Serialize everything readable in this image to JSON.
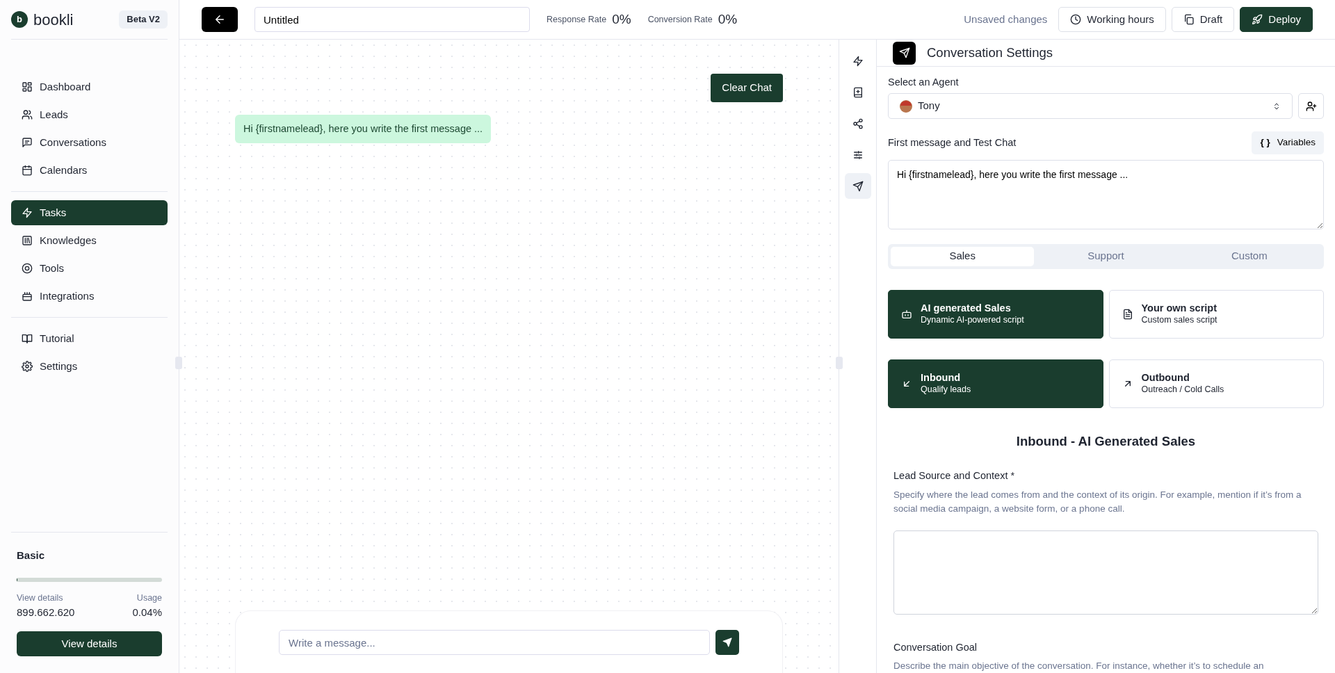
{
  "sidebar": {
    "brand": {
      "letter": "b",
      "name": "bookli",
      "badge": "Beta V2"
    },
    "nav_groups": [
      [
        {
          "label": "Dashboard",
          "selected": false
        },
        {
          "label": "Leads",
          "selected": false
        },
        {
          "label": "Conversations",
          "selected": false
        },
        {
          "label": "Calendars",
          "selected": false
        }
      ],
      [
        {
          "label": "Tasks",
          "selected": true
        },
        {
          "label": "Knowledges",
          "selected": false
        },
        {
          "label": "Tools",
          "selected": false
        },
        {
          "label": "Integrations",
          "selected": false
        }
      ],
      [
        {
          "label": "Tutorial",
          "selected": false
        },
        {
          "label": "Settings",
          "selected": false
        }
      ]
    ],
    "plan": {
      "name": "Basic",
      "level": 0.0004,
      "details_label": "View details",
      "details_value": "899.662.620",
      "usage_label": "Usage",
      "usage_value": "0.04%",
      "button": "View details"
    }
  },
  "topbar": {
    "title_value": "Untitled",
    "stats": [
      {
        "label": "Response Rate",
        "value": "0%"
      },
      {
        "label": "Conversion Rate",
        "value": "0%"
      }
    ],
    "unsaved": "Unsaved changes",
    "buttons": [
      {
        "label": "Working hours",
        "kind": "outline"
      },
      {
        "label": "Draft",
        "kind": "outline"
      },
      {
        "label": "Deploy",
        "kind": "primary"
      }
    ]
  },
  "chat": {
    "clear_button": "Clear Chat",
    "messages": [
      {
        "text": "Hi {firstnamelead}, here you write the first message ..."
      }
    ],
    "input": {
      "placeholder": "Write a message..."
    }
  },
  "rail": {
    "items": [
      {
        "selected": false
      },
      {
        "selected": false
      },
      {
        "selected": false
      },
      {
        "selected": false
      },
      {
        "selected": true
      }
    ]
  },
  "settings": {
    "title": "Conversation Settings",
    "agent_label": "Select an Agent",
    "agent_value": "Tony",
    "first_message_label": "First message and Test Chat",
    "variables_button": "Variables",
    "variables_glyph": "{ }",
    "first_message_value": "Hi {firstnamelead}, here you write the first message ...",
    "tabs": [
      {
        "label": "Sales",
        "selected": true
      },
      {
        "label": "Support",
        "selected": false
      },
      {
        "label": "Custom",
        "selected": false
      }
    ],
    "script_options": [
      {
        "title": "AI generated Sales",
        "subtitle": "Dynamic AI-powered script",
        "selected": true
      },
      {
        "title": "Your own script",
        "subtitle": "Custom sales script",
        "selected": false
      }
    ],
    "direction_options": [
      {
        "title": "Inbound",
        "subtitle": "Qualify leads",
        "selected": true
      },
      {
        "title": "Outbound",
        "subtitle": "Outreach / Cold Calls",
        "selected": false
      }
    ],
    "section_title": "Inbound - AI Generated Sales",
    "fields": [
      {
        "label": "Lead Source and Context *",
        "description": "Specify where the lead comes from and the context of its origin. For example, mention if it’s from a social media campaign, a website form, or a phone call."
      },
      {
        "label": "Conversation Goal",
        "description": "Describe the main objective of the conversation. For instance, whether it’s to schedule an"
      }
    ]
  }
}
